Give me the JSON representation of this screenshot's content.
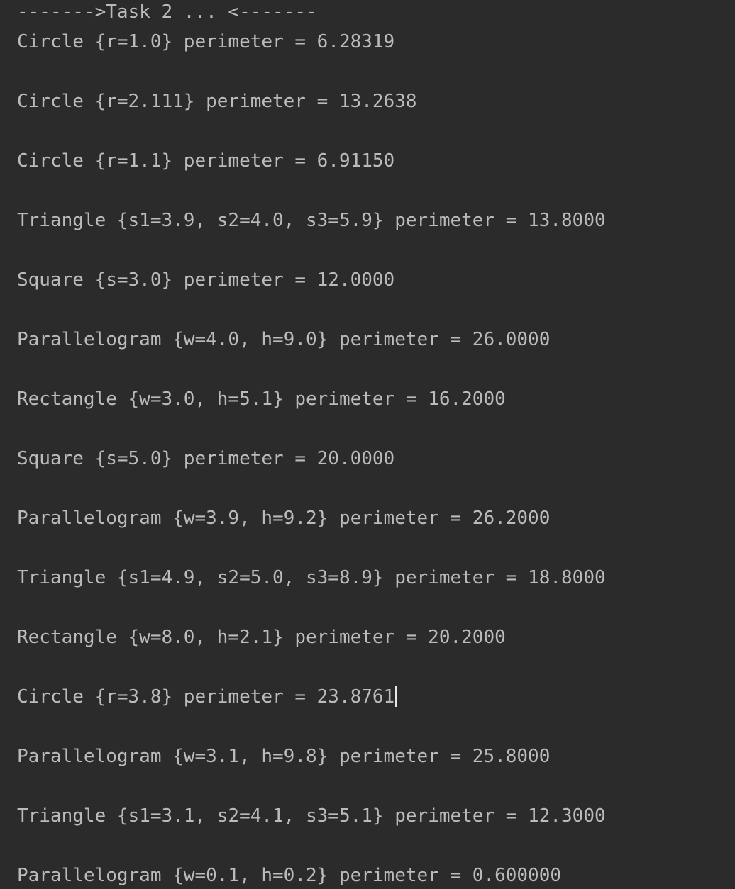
{
  "console": {
    "header": "------->Task 2 ... <-------",
    "lines": [
      "Circle {r=1.0} perimeter = 6.28319",
      "Circle {r=2.111} perimeter = 13.2638",
      "Circle {r=1.1} perimeter = 6.91150",
      "Triangle {s1=3.9, s2=4.0, s3=5.9} perimeter = 13.8000",
      "Square {s=3.0} perimeter = 12.0000",
      "Parallelogram {w=4.0, h=9.0} perimeter = 26.0000",
      "Rectangle {w=3.0, h=5.1} perimeter = 16.2000",
      "Square {s=5.0} perimeter = 20.0000",
      "Parallelogram {w=3.9, h=9.2} perimeter = 26.2000",
      "Triangle {s1=4.9, s2=5.0, s3=8.9} perimeter = 18.8000",
      "Rectangle {w=8.0, h=2.1} perimeter = 20.2000",
      "Circle {r=3.8} perimeter = 23.8761",
      "Parallelogram {w=3.1, h=9.8} perimeter = 25.8000",
      "Triangle {s1=3.1, s2=4.1, s3=5.1} perimeter = 12.3000",
      "Parallelogram {w=0.1, h=0.2} perimeter = 0.600000"
    ]
  },
  "colors": {
    "background": "#2b2b2b",
    "text": "#bbbbbb",
    "caret": "#e6e6e6"
  }
}
